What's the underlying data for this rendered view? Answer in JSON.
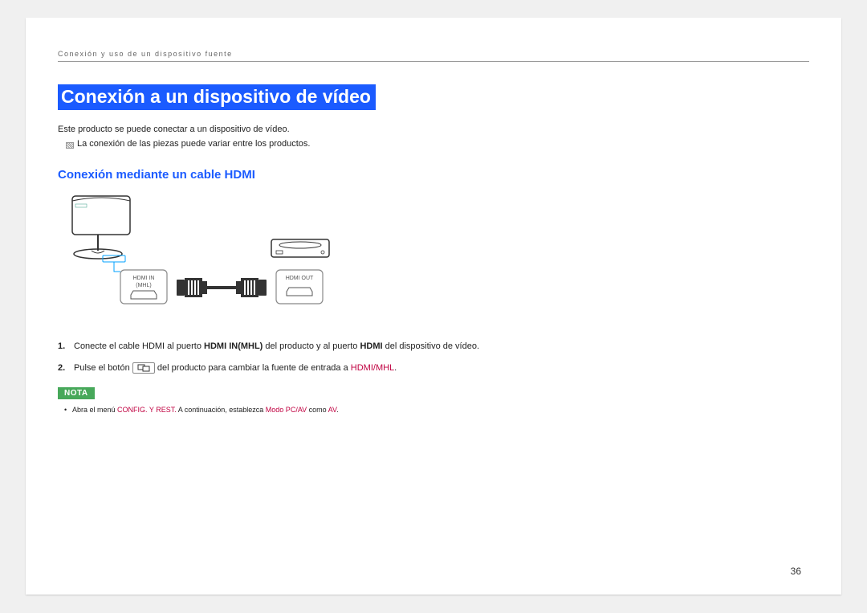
{
  "breadcrumb": "Conexión y uso de un dispositivo fuente",
  "heading_main": "Conexión a un dispositivo de vídeo",
  "intro_text": "Este producto se puede conectar a un dispositivo de vídeo.",
  "intro_note": "La conexión de las piezas puede variar entre los productos.",
  "subheading": "Conexión mediante un cable HDMI",
  "diagram": {
    "port_in_line1": "HDMI IN",
    "port_in_line2": "(MHL)",
    "port_out": "HDMI OUT"
  },
  "steps": [
    {
      "num": "1.",
      "parts": [
        {
          "t": "Conecte el cable HDMI al puerto "
        },
        {
          "t": "HDMI IN(MHL)",
          "bold": true
        },
        {
          "t": " del producto y al puerto "
        },
        {
          "t": "HDMI",
          "bold": true
        },
        {
          "t": " del dispositivo de vídeo."
        }
      ]
    },
    {
      "num": "2.",
      "parts": [
        {
          "t": "Pulse el botón "
        },
        {
          "icon": true
        },
        {
          "t": " del producto para cambiar la fuente de entrada a "
        },
        {
          "t": "HDMI/MHL",
          "red": true
        },
        {
          "t": "."
        }
      ]
    }
  ],
  "nota_label": "NOTA",
  "nota_bullet_parts": [
    {
      "t": "Abra el menú "
    },
    {
      "t": "CONFIG. Y REST.",
      "red": true
    },
    {
      "t": " A continuación, establezca "
    },
    {
      "t": "Modo PC/AV",
      "red": true
    },
    {
      "t": " como "
    },
    {
      "t": "AV",
      "red": true
    },
    {
      "t": "."
    }
  ],
  "page_number": "36"
}
